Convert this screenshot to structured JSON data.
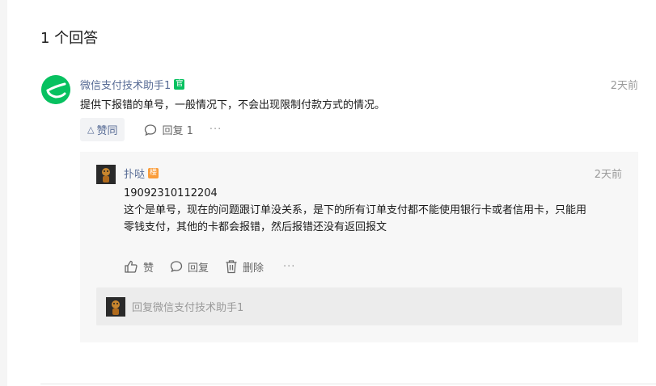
{
  "answers_header": {
    "count_text": "1 个回答"
  },
  "answer": {
    "author": "微信支付技术助手1",
    "official_badge": "官",
    "time": "2天前",
    "text": "提供下报错的单号，一般情况下，不会出现限制付款方式的情况。",
    "like_label": "赞同",
    "reply_label": "回复 1",
    "more_label": "···",
    "avatar_icon": "wechat-logo-icon",
    "brand_color": "#07c160"
  },
  "reply": {
    "author": "扑哒",
    "op_badge": "楼",
    "time": "2天前",
    "lines": [
      "19092310112204",
      "这个是单号，现在的问题跟订单没关系，是下的所有订单支付都不能使用银行卡或者信用卡，只能用",
      "零钱支付，其他的卡都会报错，然后报错还没有返回报文"
    ],
    "actions": {
      "like_label": "赞",
      "reply_label": "回复",
      "delete_label": "删除",
      "more_label": "···"
    },
    "input_placeholder": "回复微信支付技术助手1",
    "link_color": "#576b95"
  }
}
